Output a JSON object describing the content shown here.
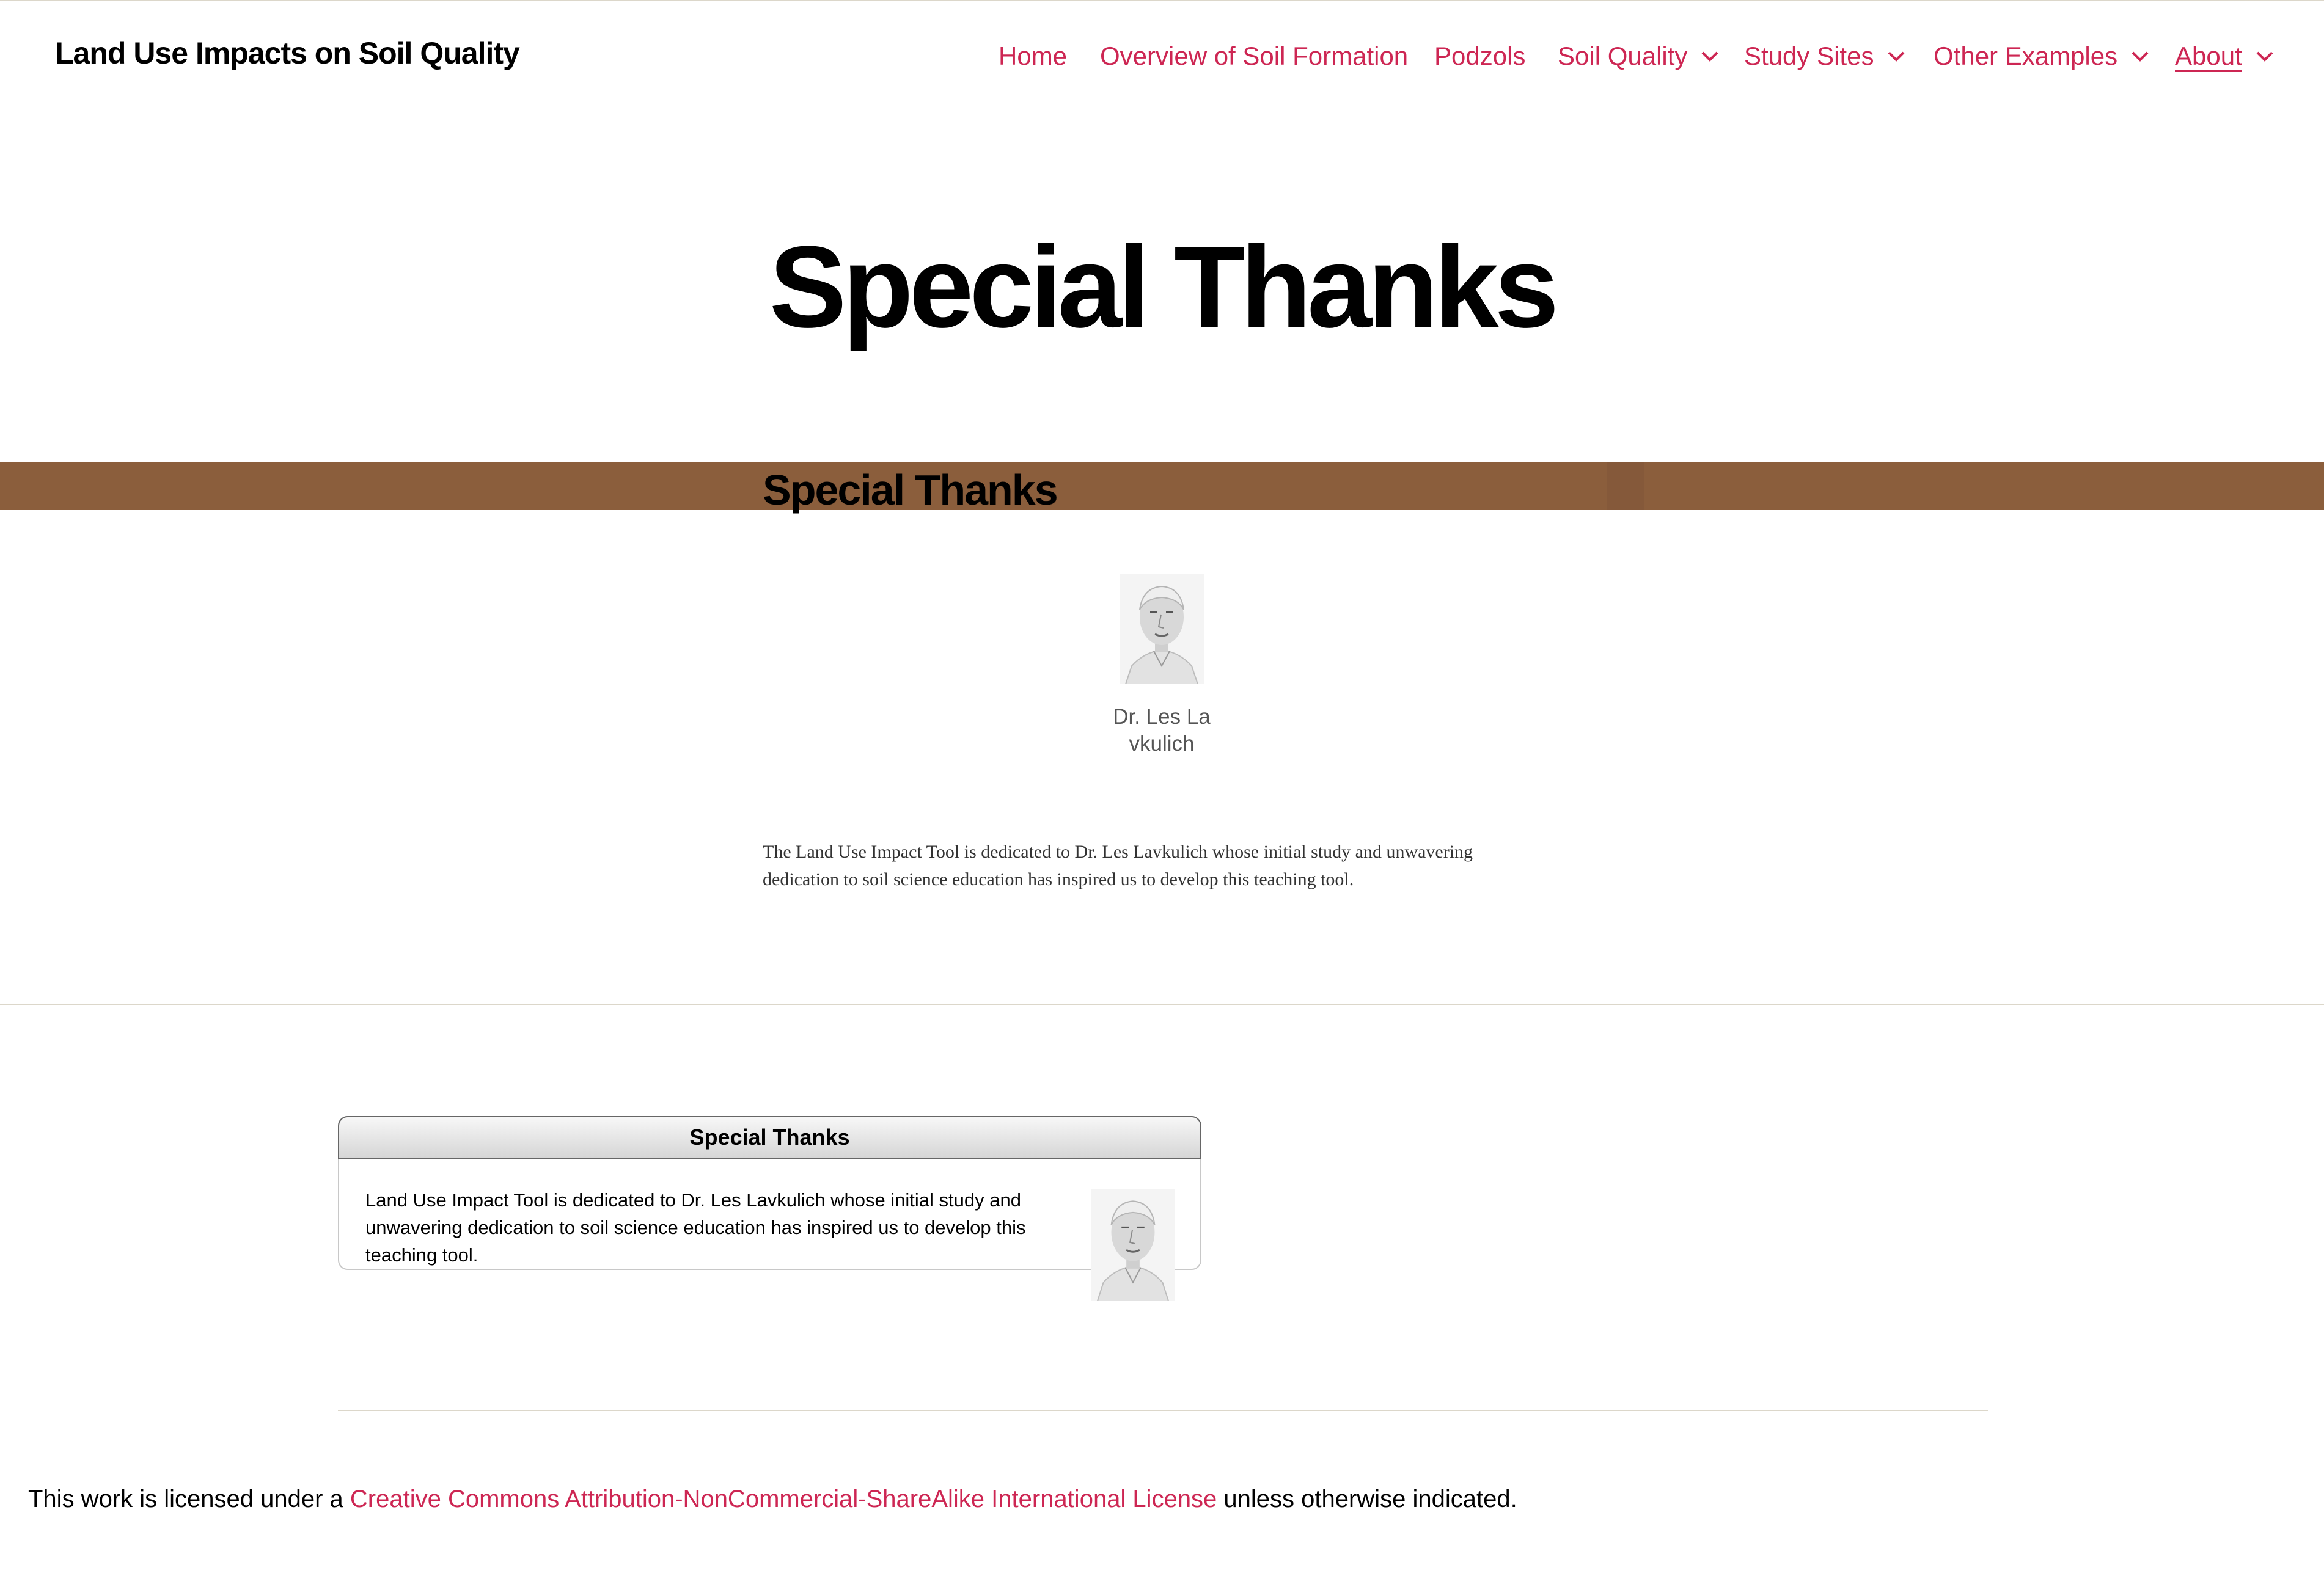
{
  "header": {
    "site_title": "Land Use Impacts on Soil Quality",
    "nav": [
      {
        "label": "Home",
        "has_dropdown": false
      },
      {
        "label": "Overview of Soil Formation",
        "has_dropdown": false
      },
      {
        "label": "Podzols",
        "has_dropdown": false
      },
      {
        "label": "Soil Quality",
        "has_dropdown": true
      },
      {
        "label": "Study Sites",
        "has_dropdown": true
      },
      {
        "label": "Other Examples",
        "has_dropdown": true
      },
      {
        "label": "About",
        "has_dropdown": true,
        "active": true
      }
    ]
  },
  "page": {
    "title": "Special Thanks",
    "band_heading": "Special Thanks",
    "person_name": "Dr. Les Lavkulich",
    "dedication": "The Land Use Impact Tool is dedicated to Dr. Les Lavkulich whose initial study and unwavering dedication to soil science education has inspired us to develop this teaching tool."
  },
  "card": {
    "heading": "Special Thanks",
    "text": "Land Use Impact Tool is dedicated to Dr. Les Lavkulich whose initial study and unwavering dedication to soil science education has inspired us to develop this teaching tool."
  },
  "footer": {
    "license_prefix": "This work is licensed under a ",
    "license_link": "Creative Commons Attribution-NonCommercial-ShareAlike International License",
    "license_suffix": " unless otherwise indicated."
  },
  "colors": {
    "accent": "#cd2653",
    "band": "#8b5e3c",
    "divider": "#dcd7ca"
  },
  "icons": {
    "dropdown": "chevron-down-icon"
  }
}
